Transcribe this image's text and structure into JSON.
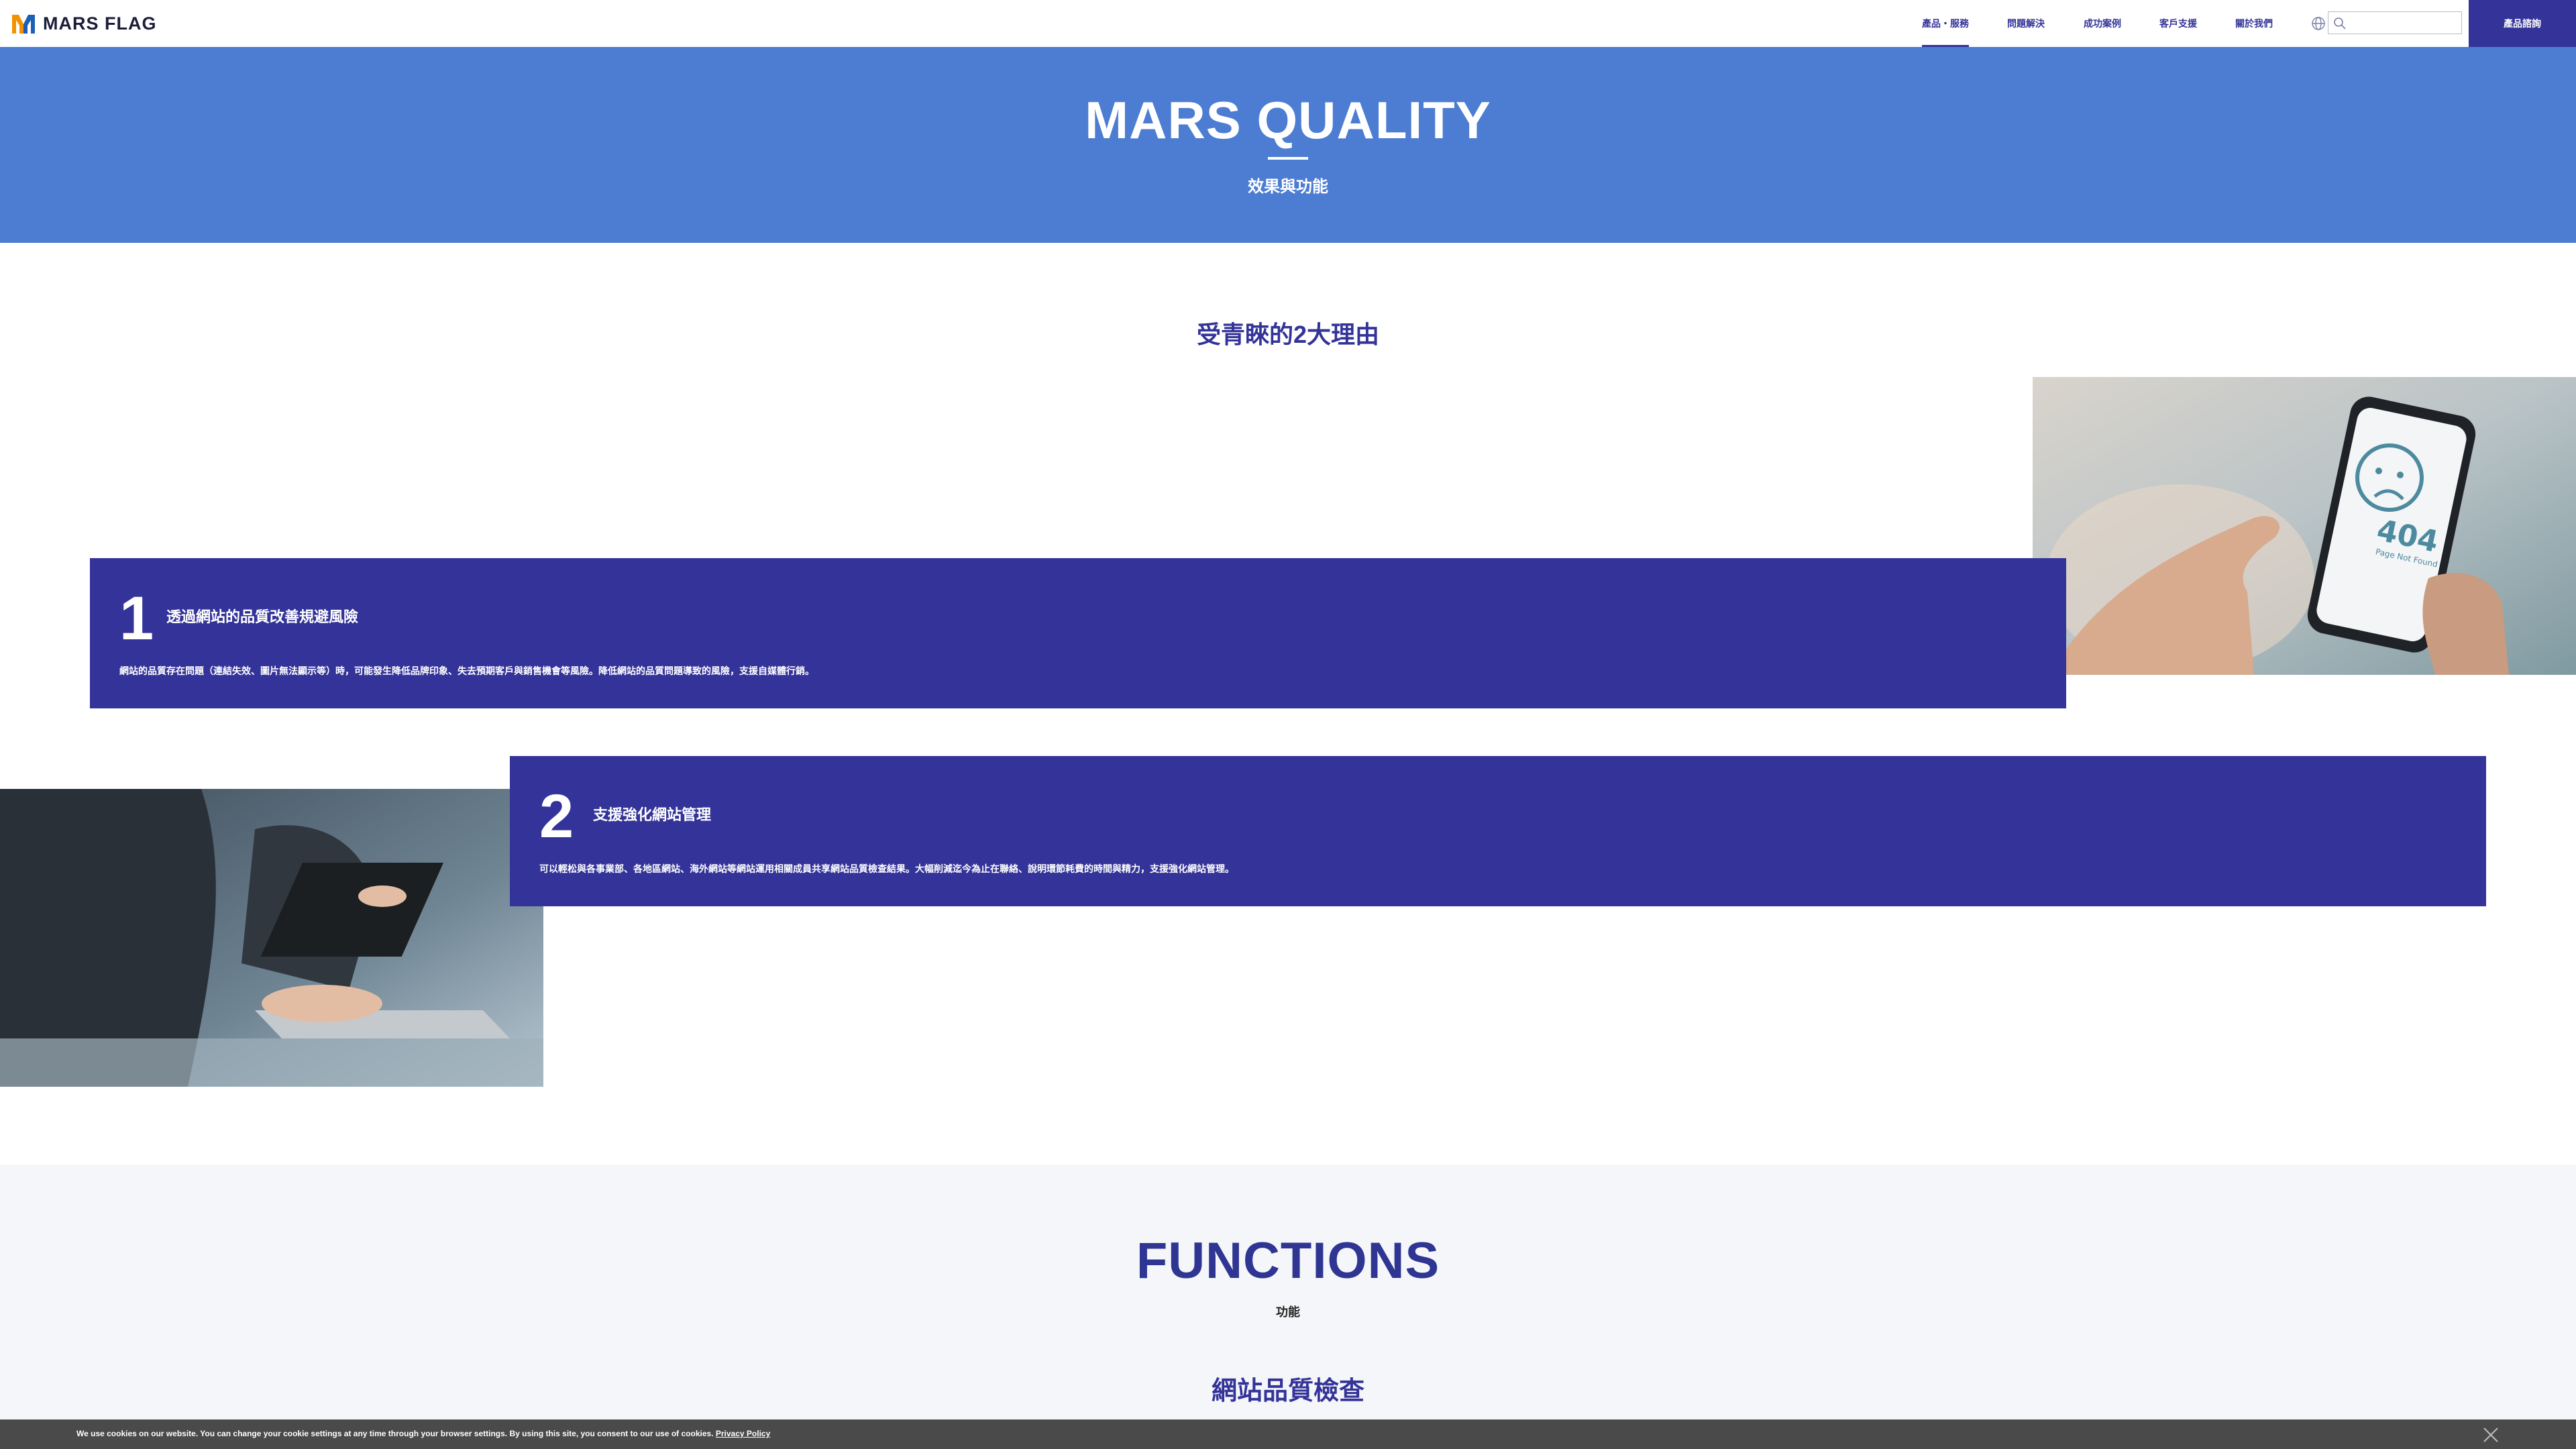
{
  "brand": {
    "name": "MARS FLAG",
    "colors": {
      "primary": "#333399",
      "hero": "#4c7dd2",
      "logo_orange": "#f39200",
      "logo_blue": "#1d5fb4"
    }
  },
  "nav": {
    "items": [
      {
        "label": "產品・服務",
        "active": true
      },
      {
        "label": "問題解決",
        "active": false
      },
      {
        "label": "成功案例",
        "active": false
      },
      {
        "label": "客戶支援",
        "active": false
      },
      {
        "label": "關於我們",
        "active": false
      }
    ],
    "language_icon": "globe-icon",
    "search": {
      "icon": "search-icon",
      "placeholder": "",
      "value": ""
    },
    "cta_label": "產品諮詢"
  },
  "hero": {
    "title": "MARS QUALITY",
    "subtitle": "效果與功能"
  },
  "reasons": {
    "heading": "受青睞的2大理由",
    "items": [
      {
        "number": "1",
        "title": "透過網站的品質改善規避風險",
        "description": "網站的品質存在問題（連結失效、圖片無法顯示等）時，可能發生降低品牌印象、失去預期客戶與銷售機會等風險。降低網站的品質問題導致的風險，支援自媒體行銷。",
        "image": "phone-404-photo"
      },
      {
        "number": "2",
        "title": "支援強化網站管理",
        "description": "可以輕松與各事業部、各地區網站、海外網站等網站運用相關成員共享網站品質檢查結果。大幅削減迄今為止在聯絡、說明環節耗費的時間與精力，支援強化網站管理。",
        "image": "laptop-meeting-photo"
      }
    ]
  },
  "functions": {
    "title": "FUNCTIONS",
    "subtitle": "功能",
    "first_heading": "網站品質檢查"
  },
  "cookie": {
    "text": "We use cookies on our website. You can change your cookie settings at any time through your browser settings. By using this site, you consent to our use of cookies.",
    "link": "Privacy Policy",
    "close_icon": "close-icon"
  }
}
